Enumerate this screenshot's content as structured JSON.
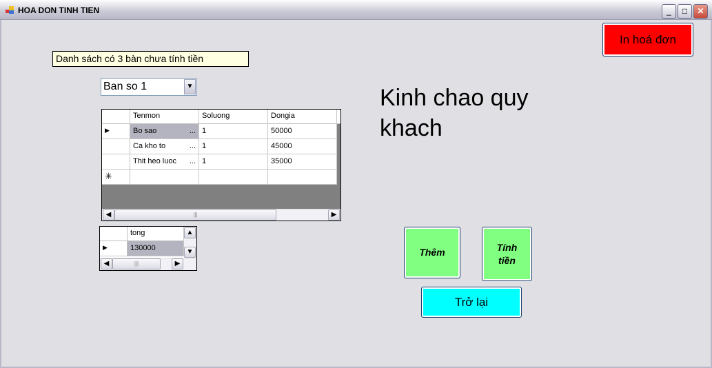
{
  "window": {
    "title": "HOA DON TINH TIEN",
    "minimize": "_",
    "maximize": "□",
    "close": "✕"
  },
  "info_label": "Danh sách có 3 bàn chưa tính tiền",
  "table_select": {
    "value": "Ban so 1"
  },
  "greeting": "Kinh chao quy khach",
  "buttons": {
    "print": "In hoá đơn",
    "add": "Thêm",
    "calc": "Tính tiền",
    "back": "Trở lại"
  },
  "items_grid": {
    "columns": [
      "Tenmon",
      "Soluong",
      "Dongia"
    ],
    "rows": [
      [
        "Bo sao",
        "1",
        "50000"
      ],
      [
        "Ca kho to",
        "1",
        "45000"
      ],
      [
        "Thit heo luoc",
        "1",
        "35000"
      ]
    ],
    "ellipsis": "..."
  },
  "total_grid": {
    "columns": [
      "tong"
    ],
    "rows": [
      [
        "130000"
      ]
    ]
  },
  "colors": {
    "print": "#ff0000",
    "action": "#80ff80",
    "back": "#00ffff",
    "info_bg": "#ffffe1"
  }
}
